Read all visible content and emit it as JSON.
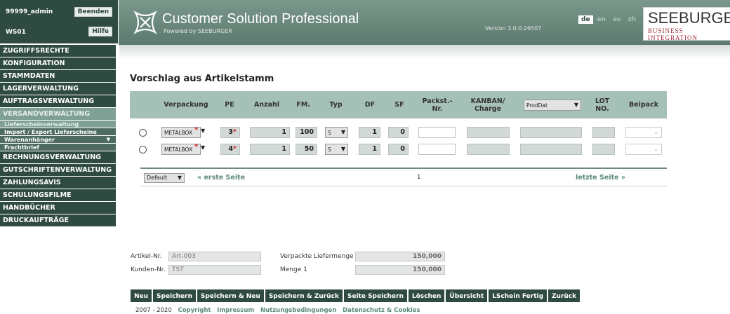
{
  "user": {
    "name": "99999_admin",
    "client": "WS01",
    "logout_label": "Beenden",
    "help_label": "Hilfe"
  },
  "header": {
    "title": "Customer Solution Professional",
    "subtitle": "Powered by SEEBURGER",
    "version": "Version 3.0.0.26507",
    "languages": [
      "de",
      "en",
      "es",
      "zh"
    ],
    "active_language": "de",
    "brand_main": "SEEBURGER",
    "brand_sub": "BUSINESS INTEGRATION"
  },
  "nav": {
    "items": [
      "ZUGRIFFSRECHTE",
      "KONFIGURATION",
      "STAMMDATEN",
      "LAGERVERWALTUNG",
      "AUFTRAGSVERWALTUNG",
      "VERSANDVERWALTUNG",
      "RECHNUNGSVERWALTUNG",
      "GUTSCHRIFTENVERWALTUNG",
      "ZAHLUNGSAVIS",
      "SCHULUNGSFILME",
      "HANDBÜCHER",
      "DRUCKAUFTRÄGE"
    ],
    "subitems": [
      "Lieferscheinverwaltung",
      "Import / Export Lieferscheine",
      "Warenanhänger",
      "Frachtbrief"
    ]
  },
  "page": {
    "title": "Vorschlag aus Artikelstamm"
  },
  "table": {
    "headers": [
      "Verpackung",
      "PE",
      "Anzahl",
      "FM.",
      "Typ",
      "DF",
      "SF",
      "Packst.-\nNr.",
      "KANBAN/\nCharge",
      "ProdDat",
      "LOT\nNO.",
      "Beipack"
    ],
    "rows": [
      {
        "verpackung": "METALBOX",
        "pe": "3",
        "anzahl": "1",
        "fm": "100",
        "typ": "S",
        "df": "1",
        "sf": "0"
      },
      {
        "verpackung": "METALBOX",
        "pe": "4",
        "anzahl": "1",
        "fm": "50",
        "typ": "S",
        "df": "1",
        "sf": "0"
      }
    ],
    "required_marker": "*"
  },
  "pager": {
    "view": "Default",
    "first": "« erste Seite",
    "page": "1",
    "last": "letzte Seite »"
  },
  "info": {
    "artikel_label": "Artikel-Nr.",
    "artikel_value": "Art-003",
    "kunden_label": "Kunden-Nr.",
    "kunden_value": "TST",
    "menge_label": "Verpackte Liefermenge",
    "menge_value": "150,000",
    "menge1_label": "Menge 1",
    "menge1_value": "150,000"
  },
  "buttons": [
    "Neu",
    "Speichern",
    "Speichern & Neu",
    "Speichern & Zurück",
    "Seite Speichern",
    "Löschen",
    "Übersicht",
    "LSchein Fertig",
    "Zurück"
  ],
  "footer": {
    "years": "2007 - 2020",
    "links": [
      "Copyright",
      "Impressum",
      "Nutzungsbedingungen",
      "Datenschutz & Cookies"
    ]
  },
  "colors": {
    "nav_bg": "#2f4a40",
    "header_bg": "#6a887c",
    "table_head": "#a5c0b6",
    "link": "#5c8a79",
    "required": "#d01d1d"
  }
}
